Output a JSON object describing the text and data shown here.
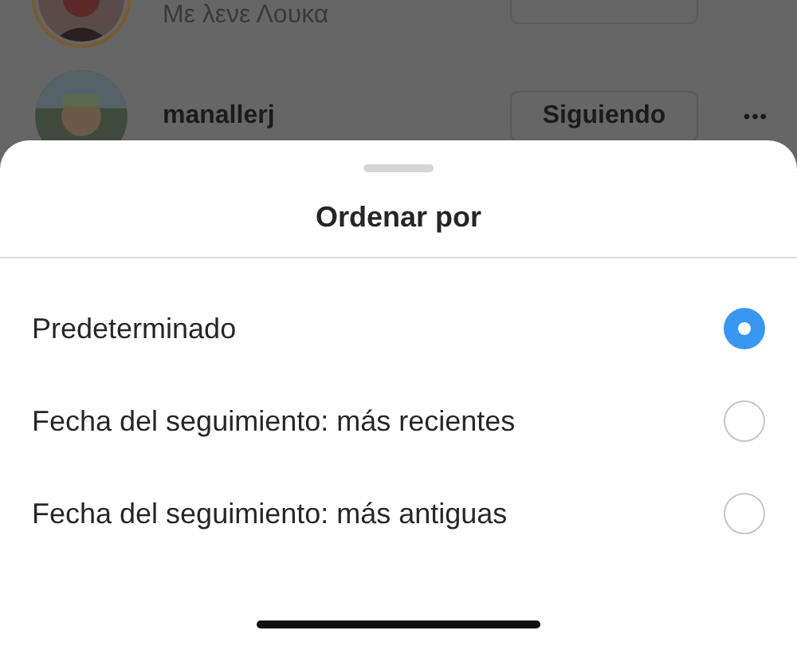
{
  "background_list": [
    {
      "subtitle": "Με λενε Λουκα"
    },
    {
      "username": "manallerj",
      "button": "Siguiendo",
      "more": "•••"
    }
  ],
  "sheet": {
    "title": "Ordenar por",
    "options": [
      {
        "label": "Predeterminado",
        "selected": true
      },
      {
        "label": "Fecha del seguimiento: más recientes",
        "selected": false
      },
      {
        "label": "Fecha del seguimiento: más antiguas",
        "selected": false
      }
    ]
  }
}
